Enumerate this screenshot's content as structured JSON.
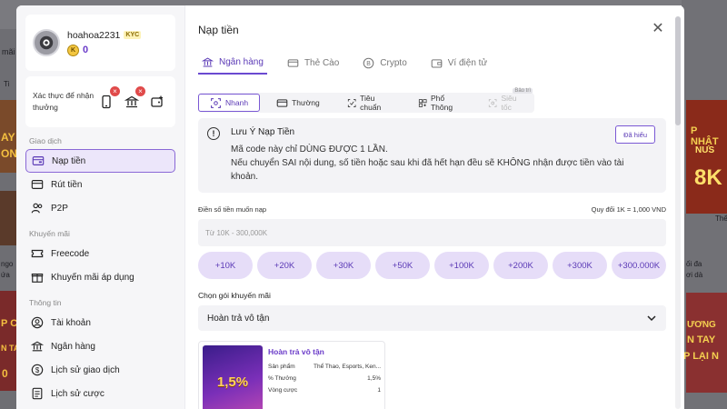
{
  "background": {
    "balance": "0",
    "side_labels": [
      "mãi",
      "Ti",
      "ngo",
      "ứa",
      "T"
    ],
    "right_labels": [
      "P NHẬT",
      "NUS",
      "8K",
      "Thể",
      "ối đa",
      "ơi dà",
      "ƯƠNG",
      "N TAY",
      "P LẠI N"
    ],
    "left_banner_labels": [
      "AY",
      "ON",
      "P C",
      "N TA",
      "0"
    ]
  },
  "profile": {
    "username": "hoahoa2231",
    "kyc_label": "KYC",
    "balance": "0",
    "coin_glyph": "K"
  },
  "verify": {
    "label": "Xác thực để nhận thưởng"
  },
  "sidebar": {
    "sections": [
      {
        "title": "Giao dịch",
        "items": [
          {
            "label": "Nạp tiền",
            "icon": "deposit-icon"
          },
          {
            "label": "Rút tiền",
            "icon": "withdraw-icon"
          },
          {
            "label": "P2P",
            "icon": "p2p-icon"
          }
        ]
      },
      {
        "title": "Khuyến mãi",
        "items": [
          {
            "label": "Freecode",
            "icon": "ticket-icon"
          },
          {
            "label": "Khuyến mãi áp dụng",
            "icon": "gift-icon"
          }
        ]
      },
      {
        "title": "Thông tin",
        "items": [
          {
            "label": "Tài khoản",
            "icon": "user-icon"
          },
          {
            "label": "Ngân hàng",
            "icon": "bank-icon"
          },
          {
            "label": "Lịch sử giao dịch",
            "icon": "dollar-icon"
          },
          {
            "label": "Lịch sử cược",
            "icon": "history-icon"
          }
        ]
      }
    ]
  },
  "main": {
    "title": "Nạp tiền",
    "close_glyph": "✕",
    "tabs": [
      {
        "label": "Ngân hàng",
        "icon": "bank-icon"
      },
      {
        "label": "Thẻ Cào",
        "icon": "card-icon"
      },
      {
        "label": "Crypto",
        "icon": "bitcoin-icon"
      },
      {
        "label": "Ví điện tử",
        "icon": "wallet-icon"
      }
    ],
    "methods": [
      {
        "label": "Nhanh"
      },
      {
        "label": "Thường"
      },
      {
        "label": "Tiêu chuẩn"
      },
      {
        "label": "Phổ Thông"
      },
      {
        "label": "Siêu tốc",
        "badge": "Bảo trì"
      }
    ],
    "notice": {
      "icon_glyph": "!",
      "title": "Lưu Ý Nạp Tiền",
      "line1": "Mã code này chỉ DÙNG ĐƯỢC 1 LẦN.",
      "line2": "Nếu chuyển SAI nội dung, số tiền hoặc sau khi đã hết hạn đều sẽ KHÔNG nhận được tiền vào tài",
      "line3": "khoản.",
      "button": "Đã hiểu"
    },
    "amount": {
      "label": "Điền số tiền muốn nạp",
      "rate": "Quy đổi 1K = 1,000 VND",
      "placeholder": "Từ 10K - 300,000K",
      "value": ""
    },
    "chips": [
      "+10K",
      "+20K",
      "+30K",
      "+50K",
      "+100K",
      "+200K",
      "+300K",
      "+300.000K"
    ],
    "promo": {
      "label": "Chọn gói khuyến mãi",
      "selected": "Hoàn trả vô tận"
    },
    "promo_card": {
      "image_text": "1,5%",
      "title": "Hoàn trả vô tận",
      "rows": [
        {
          "key": "Sản phẩm",
          "value": "Thể Thao, Esports, Ken..."
        },
        {
          "key": "% Thưởng",
          "value": "1,5%"
        },
        {
          "key": "Vòng cược",
          "value": "1"
        }
      ]
    }
  },
  "colors": {
    "accent": "#6a49d1",
    "chip_bg": "#e6ddf8",
    "overlay": "#6e6e73"
  }
}
